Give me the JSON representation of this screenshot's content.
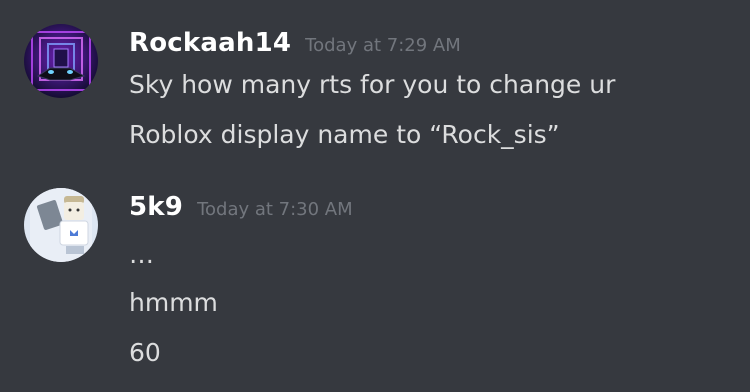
{
  "messages": [
    {
      "username": "Rockaah14",
      "timestamp": "Today at 7:29 AM",
      "lines": [
        "Sky how many rts for you to change ur",
        "Roblox display name to “Rock_sis”"
      ]
    },
    {
      "username": "5k9",
      "timestamp": "Today at 7:30 AM",
      "lines": [
        "…",
        "hmmm",
        "60"
      ]
    }
  ],
  "colors": {
    "background": "#36393f",
    "username": "#ffffff",
    "timestamp": "#72767d",
    "text": "#dcddde"
  }
}
